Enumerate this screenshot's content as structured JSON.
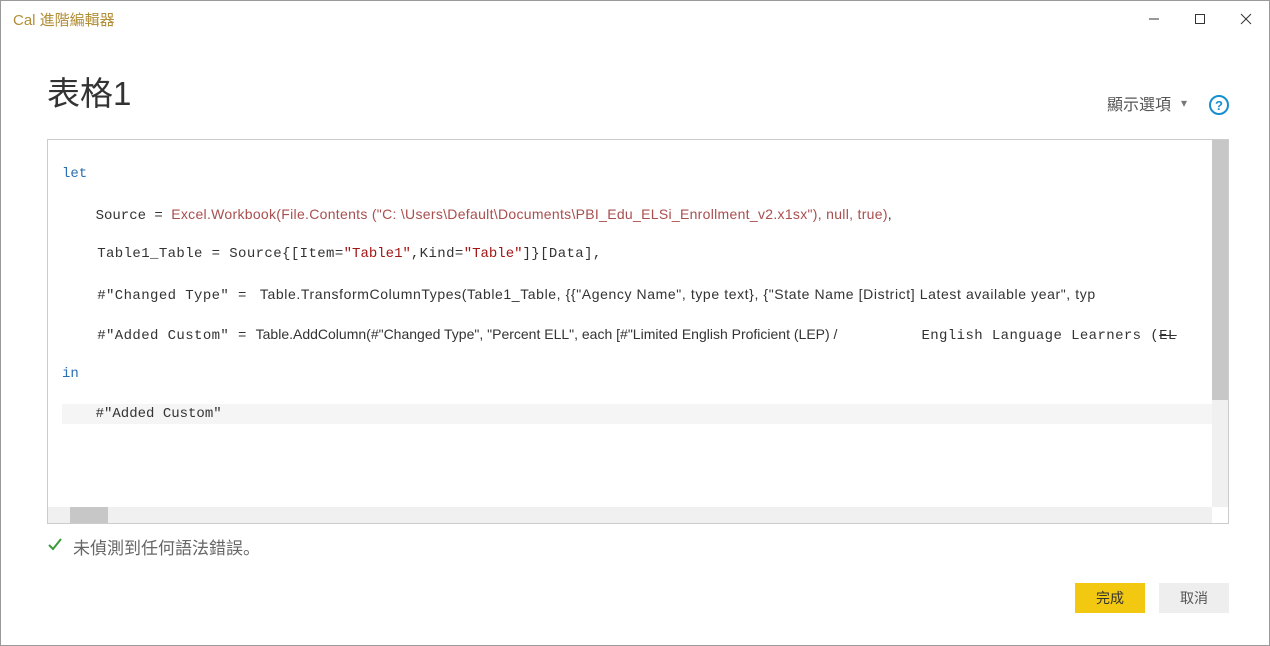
{
  "window": {
    "title": "Cal 進階編輯器"
  },
  "page": {
    "title": "表格1"
  },
  "toolbar": {
    "display_options_label": "顯示選項",
    "help_tooltip": "?"
  },
  "code": {
    "line1_keyword": "let",
    "line2_prefix": "    Source = ",
    "line2_call": "Excel.Workbook(File.Contents (\"C: \\Users\\Default\\Documents\\PBI_Edu_ELSi_Enrollment_v2.x1sx\"), null, true)",
    "line2_tail": ",",
    "line3_a": "    Table1_Table = Source{[Item=",
    "line3_str1": "\"Table1\"",
    "line3_b": ",Kind=",
    "line3_str2": "\"Table\"",
    "line3_c": "]}[Data],",
    "line4_a": "    #\"Changed Type\" = ",
    "line4_b": " Table.TransformColumnTypes(Table1_Table, {{\"Agency Name\", type text}, {\"State Name [District] Latest available year\", typ",
    "line5_a": "    #\"Added Custom\" = ",
    "line5_b": "Table.AddColumn(#\"Changed Type\", \"Percent ELL\", each [#\"Limited English Proficient (LEP) /",
    "line5_gap": "          ",
    "line5_c_pre": "English Language Learners (",
    "line5_c_strike": "EL",
    "line6_keyword": "in",
    "line7": "    #\"Added Custom\""
  },
  "status": {
    "message": "未偵測到任何語法錯誤。"
  },
  "buttons": {
    "done": "完成",
    "cancel": "取消"
  }
}
